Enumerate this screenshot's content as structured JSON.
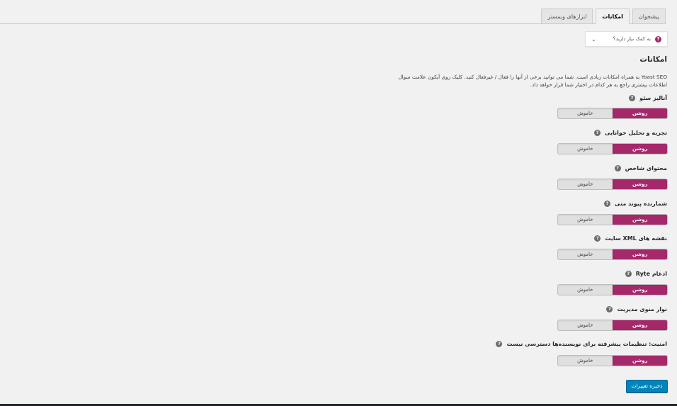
{
  "tabs": [
    {
      "label": "پیشخوان"
    },
    {
      "label": "امکانات"
    },
    {
      "label": "ابزارهای وبمستر"
    }
  ],
  "help": {
    "label": "به کمک نیاز دارید؟"
  },
  "page": {
    "heading": "امکانات",
    "description": "Yoast SEO به همراه امکانات زیادی است. شما می توانید برخی از آنها را فعال / غیرفعال کنید. کلیک روی آیکون علامت سوال اطلاعات بیشتری راجع به هر کدام در اختیار شما قرار خواهد داد."
  },
  "toggle_labels": {
    "on": "روشن",
    "off": "خاموش"
  },
  "features": [
    {
      "label": "آنالیز سئو",
      "state": "on"
    },
    {
      "label": "تجزیه و تحلیل خوانایی",
      "state": "on"
    },
    {
      "label": "محتوای شاخص",
      "state": "on"
    },
    {
      "label": "شمارنده پیوند متی",
      "state": "on"
    },
    {
      "label": "نقشه های XML سایت",
      "state": "on"
    },
    {
      "label": "ادغام Ryte",
      "state": "on"
    },
    {
      "label": "نوار منوی مدیریت",
      "state": "on"
    },
    {
      "label": "امنیت: تنظیمات پیشرفته برای نویسنده‌ها دسترسی نیست",
      "state": "on"
    }
  ],
  "save_button": {
    "label": "ذخیره تغییرات"
  },
  "colors": {
    "accent": "#a4286a",
    "primary_button": "#0085ba"
  },
  "icons": {
    "help": "question-circle-icon",
    "chevron": "chevron-down-icon"
  }
}
